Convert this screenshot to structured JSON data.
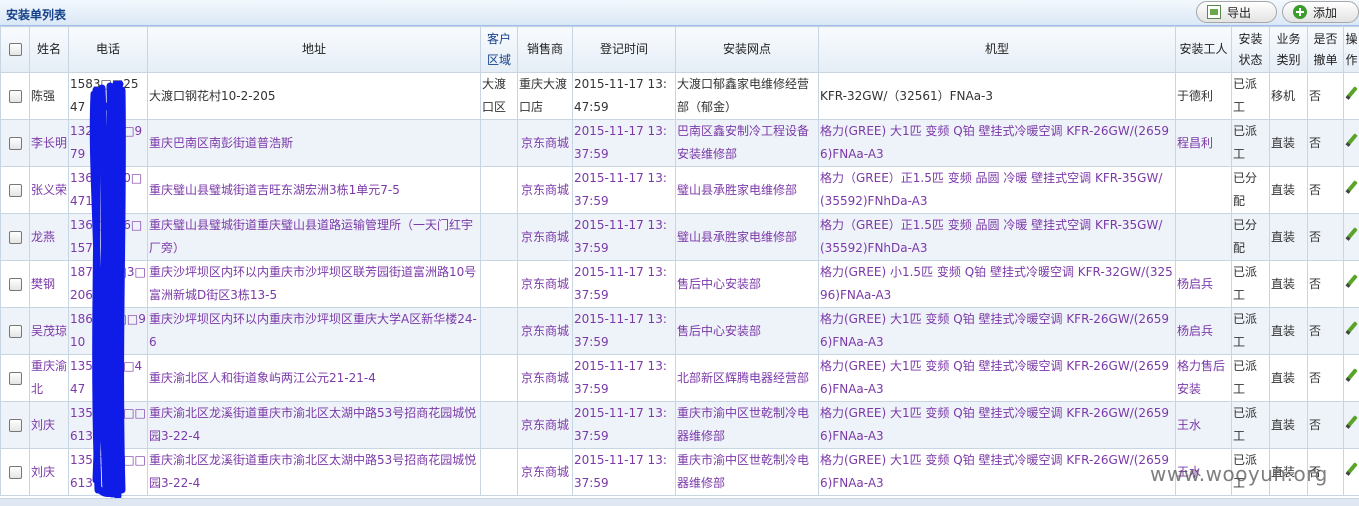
{
  "panel": {
    "title": "安装单列表",
    "export_label": "导出",
    "add_label": "添加"
  },
  "columns": [
    "姓名",
    "电话",
    "地址",
    "客户区域",
    "销售商",
    "登记时间",
    "安装网点",
    "机型",
    "安装工人",
    "安装状态",
    "业务类别",
    "是否撤单",
    "操作"
  ],
  "rows": [
    {
      "name": "陈强",
      "phone": "1583□□2547",
      "address": "大渡口钢花村10-2-205",
      "area": "大渡口区",
      "seller": "重庆大渡口店",
      "time": "2015-11-17 13:47:59",
      "station": "大渡口郁鑫家电维修经营部（郁金）",
      "model": "KFR-32GW/（32561）FNAa-3",
      "worker": "于德利",
      "status": "已派工",
      "type": "移机",
      "cancel": "否"
    },
    {
      "name": "李长明",
      "phone": "132□□1□979",
      "address": "重庆巴南区南彭街道普浩斯",
      "area": "",
      "seller": "京东商城",
      "time": "2015-11-17 13:37:59",
      "station": "巴南区鑫安制冷工程设备安装维修部",
      "model": "格力(GREE) 大1匹 变频 Q铂 壁挂式冷暖空调 KFR-26GW/(26596)FNAa-A3",
      "worker": "程昌利",
      "status": "已派工",
      "type": "直装",
      "cancel": "否"
    },
    {
      "name": "张义荣",
      "phone": "136□□00□471",
      "address": "重庆璧山县璧城街道吉旺东湖宏洲3栋1单元7-5",
      "area": "",
      "seller": "京东商城",
      "time": "2015-11-17 13:37:59",
      "station": "璧山县承胜家电维修部",
      "model": "格力（GREE）正1.5匹 变频 品圆 冷暖 壁挂式空调 KFR-35GW/(35592)FNhDa-A3",
      "worker": "",
      "status": "已分配",
      "type": "直装",
      "cancel": "否"
    },
    {
      "name": "龙燕",
      "phone": "136□□46□157",
      "address": "重庆璧山县璧城街道重庆璧山县道路运输管理所（一天门红宇厂旁）",
      "area": "",
      "seller": "京东商城",
      "time": "2015-11-17 13:37:59",
      "station": "璧山县承胜家电维修部",
      "model": "格力（GREE）正1.5匹 变频 品圆 冷暖 壁挂式空调 KFR-35GW/(35592)FNhDa-A3",
      "worker": "",
      "status": "已分配",
      "type": "直装",
      "cancel": "否"
    },
    {
      "name": "樊钢",
      "phone": "187□□□3□206",
      "address": "重庆沙坪坝区内环以内重庆市沙坪坝区联芳园街道富洲路10号富洲新城D街区3栋13-5",
      "area": "",
      "seller": "京东商城",
      "time": "2015-11-17 13:37:59",
      "station": "售后中心安装部",
      "model": "格力(GREE) 小1.5匹 变频 Q铂 壁挂式冷暖空调 KFR-32GW/(32596)FNAa-A3",
      "worker": "杨启兵",
      "status": "已派工",
      "type": "直装",
      "cancel": "否"
    },
    {
      "name": "吴茂琼",
      "phone": "186□□□□910",
      "address": "重庆沙坪坝区内环以内重庆市沙坪坝区重庆大学A区新华楼24-6",
      "area": "",
      "seller": "京东商城",
      "time": "2015-11-17 13:37:59",
      "station": "售后中心安装部",
      "model": "格力(GREE) 大1匹 变频 Q铂 壁挂式冷暖空调 KFR-26GW/(26596)FNAa-A3",
      "worker": "杨启兵",
      "status": "已派工",
      "type": "直装",
      "cancel": "否"
    },
    {
      "name": "重庆渝北",
      "phone": "135□□4□447",
      "address": "重庆渝北区人和街道象屿两江公元21-21-4",
      "area": "",
      "seller": "京东商城",
      "time": "2015-11-17 13:37:59",
      "station": "北部新区辉腾电器经营部",
      "model": "格力(GREE) 大1匹 变频 Q铂 壁挂式冷暖空调 KFR-26GW/(26596)FNAa-A3",
      "worker": "格力售后安装",
      "status": "已派工",
      "type": "直装",
      "cancel": "否"
    },
    {
      "name": "刘庆",
      "phone": "135□□9□□613",
      "address": "重庆渝北区龙溪街道重庆市渝北区太湖中路53号招商花园城悦园3-22-4",
      "area": "",
      "seller": "京东商城",
      "time": "2015-11-17 13:37:59",
      "station": "重庆市渝中区世乾制冷电器维修部",
      "model": "格力(GREE) 大1匹 变频 Q铂 壁挂式冷暖空调 KFR-26GW/(26596)FNAa-A3",
      "worker": "王水",
      "status": "已派工",
      "type": "直装",
      "cancel": "否"
    },
    {
      "name": "刘庆",
      "phone": "135□□9□□613",
      "address": "重庆渝北区龙溪街道重庆市渝北区太湖中路53号招商花园城悦园3-22-4",
      "area": "",
      "seller": "京东商城",
      "time": "2015-11-17 13:37:59",
      "station": "重庆市渝中区世乾制冷电器维修部",
      "model": "格力(GREE) 大1匹 变频 Q铂 壁挂式冷暖空调 KFR-26GW/(26596)FNAa-A3",
      "worker": "王水",
      "status": "已派工",
      "type": "直装",
      "cancel": "否"
    }
  ],
  "watermark": "www.wooyun.org"
}
